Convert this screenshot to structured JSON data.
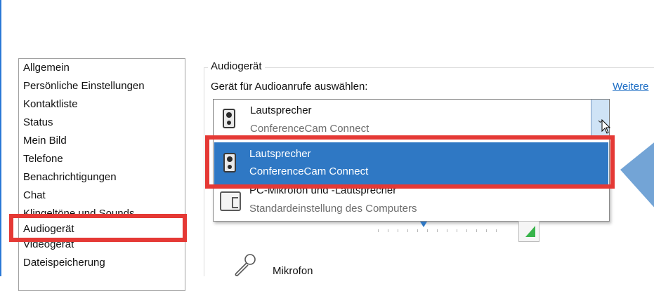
{
  "sidebar": {
    "items": [
      {
        "label": "Allgemein"
      },
      {
        "label": "Persönliche Einstellungen"
      },
      {
        "label": "Kontaktliste"
      },
      {
        "label": "Status"
      },
      {
        "label": "Mein Bild"
      },
      {
        "label": "Telefone"
      },
      {
        "label": "Benachrichtigungen"
      },
      {
        "label": "Chat"
      },
      {
        "label": "Klingeltöne und Sounds"
      },
      {
        "label": "Audiogerät"
      },
      {
        "label": "Videogerät"
      },
      {
        "label": "Dateispeicherung"
      }
    ],
    "selected": "Audiogerät"
  },
  "audio": {
    "group_title": "Audiogerät",
    "select_label": "Gerät für Audioanrufe auswählen:",
    "more_link": "Weitere",
    "combo": {
      "line1": "Lautsprecher",
      "line2": "ConferenceCam Connect"
    },
    "options": [
      {
        "line1": "Lautsprecher",
        "line2": "ConferenceCam Connect",
        "highlighted": true
      },
      {
        "line1": "PC-Mikrofon und -Lautsprecher",
        "line2": "Standardeinstellung des Computers",
        "highlighted": false
      }
    ],
    "mic_label": "Mikrofon"
  },
  "colors": {
    "highlight_box": "#e53935",
    "selection": "#2f78c4",
    "link": "#1f6fc5",
    "callout": "#73a4d6"
  }
}
